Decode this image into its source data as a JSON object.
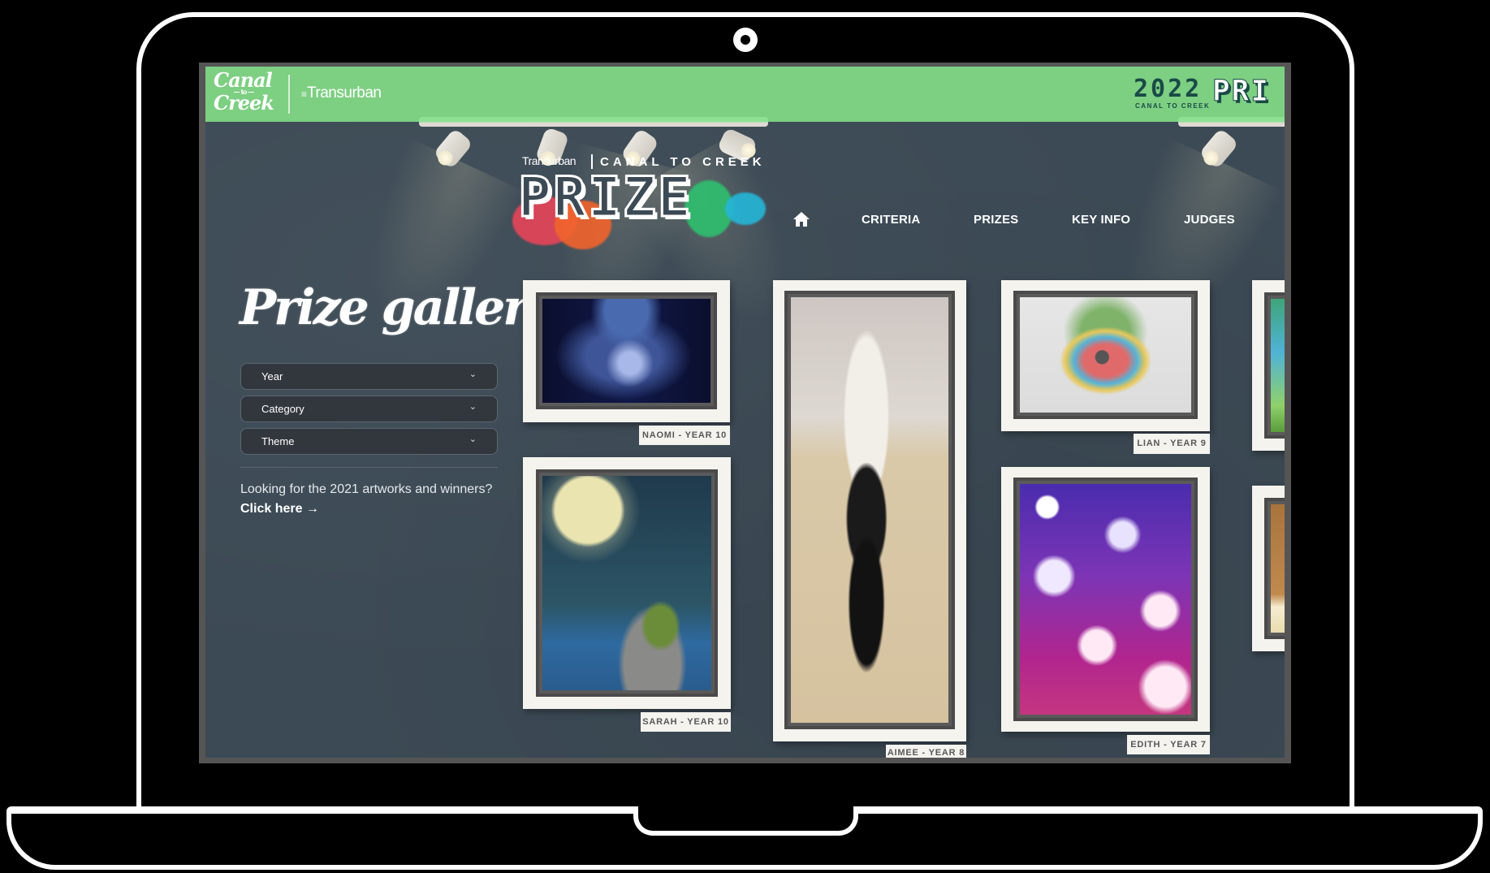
{
  "header": {
    "logo_canal_line1": "Canal",
    "logo_canal_line2": "Creek",
    "logo_transurban_lines": "≡",
    "logo_transurban": "Transurban",
    "badge_year": "2022",
    "badge_sub": "CANAL TO CREEK",
    "badge_prize": "PRI"
  },
  "brand": {
    "transurban": "Transurban",
    "subtitle": "CANAL TO CREEK",
    "title": "PRIZE"
  },
  "nav": {
    "home_icon": "home-icon",
    "items": [
      {
        "label": "CRITERIA"
      },
      {
        "label": "PRIZES"
      },
      {
        "label": "KEY INFO"
      },
      {
        "label": "JUDGES"
      }
    ]
  },
  "sidebar": {
    "title": "Prize gallery",
    "filters": [
      {
        "label": "Year",
        "icon": "chevron-down-icon"
      },
      {
        "label": "Category",
        "icon": "chevron-down-icon"
      },
      {
        "label": "Theme",
        "icon": "chevron-down-icon"
      }
    ],
    "chevron": "⌄",
    "promo_text": "Looking for the 2021 artworks and winners?",
    "promo_link": "Click here →"
  },
  "gallery": {
    "artworks": [
      {
        "caption": "NAOMI - YEAR 10"
      },
      {
        "caption": "SARAH - YEAR 10"
      },
      {
        "caption": "AIMEE - YEAR 8"
      },
      {
        "caption": "LIAN - YEAR 9"
      },
      {
        "caption": "EDITH - YEAR 7"
      }
    ]
  },
  "colors": {
    "header_green": "#7dcf82",
    "background": "#3c4a55",
    "frame": "#f4f3ee",
    "dropdown_bg": "#32373e"
  }
}
